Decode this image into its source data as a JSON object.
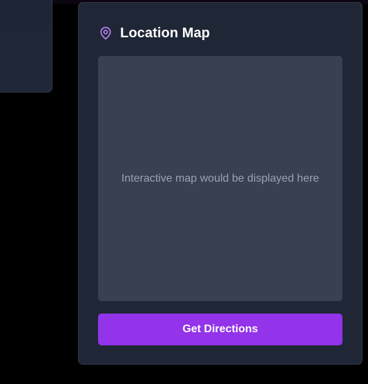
{
  "location_card": {
    "title": "Location Map",
    "icon": "map-pin-icon",
    "map_placeholder": "Interactive map would be displayed here",
    "directions_button_label": "Get Directions"
  },
  "colors": {
    "background": "#000000",
    "card": "#1f2736",
    "map_area": "#374151",
    "accent": "#9333ea",
    "icon": "#c084fc",
    "placeholder_text": "#9ca3af"
  }
}
